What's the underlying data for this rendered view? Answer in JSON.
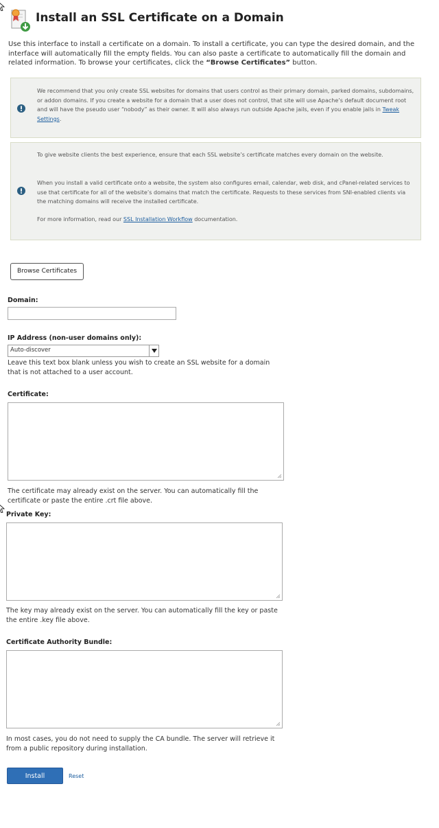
{
  "page": {
    "title": "Install an SSL Certificate on a Domain",
    "intro_text": "Use this interface to install a certificate on a domain. To install a certificate, you can type the desired domain, and the interface will automatically fill the empty fields. You can also paste a certificate to automatically fill the domain and related information. To browse your certificates, click the ",
    "intro_bold": "“Browse Certificates”",
    "intro_end": " button."
  },
  "callout1": {
    "text": "We recommend that you only create SSL websites for domains that users control as their primary domain, parked domains, subdomains, or addon domains. If you create a website for a domain that a user does not control, that site will use Apache’s default document root and will have the pseudo user “nobody” as their owner. It will also always run outside Apache jails, even if you enable jails in ",
    "link": "Tweak Settings",
    "end": "."
  },
  "callout2": {
    "p1": "To give website clients the best experience, ensure that each SSL website’s certificate matches every domain on the website.",
    "p2": "When you install a valid certificate onto a website, the system also configures email, calendar, web disk, and cPanel-related services to use that certificate for all of the website’s domains that match the certificate. Requests to these services from SNI-enabled clients via the matching domains will receive the installed certificate.",
    "p3_start": "For more information, read our ",
    "p3_link": "SSL Installation Workflow",
    "p3_end": " documentation."
  },
  "buttons": {
    "browse": "Browse Certificates",
    "install": "Install",
    "reset": "Reset"
  },
  "form": {
    "domain_label": "Domain:",
    "domain_value": "",
    "ip_label": "IP Address (non-user domains only):",
    "ip_selected": "Auto-discover",
    "ip_help": "Leave this text box blank unless you wish to create an SSL website for a domain that is not attached to a user account.",
    "cert_label": "Certificate:",
    "cert_help": "The certificate may already exist on the server. You can automatically fill the certificate or paste the entire .crt file above.",
    "key_label": "Private Key:",
    "key_help": "The key may already exist on the server. You can automatically fill the key or paste the entire .key file above.",
    "ca_label": "Certificate Authority Bundle:",
    "ca_help": "In most cases, you do not need to supply the CA bundle. The server will retrieve it from a public repository during installation."
  },
  "icons": {
    "title": "certificate-install-icon",
    "info": "info-icon",
    "dropdown": "dropdown-arrow-icon",
    "resize": "resize-grip-icon",
    "cursor": "mouse-cursor-icon"
  },
  "colors": {
    "primary_button": "#2f6fb6",
    "link": "#1a5c9e",
    "callout_bg": "#f0f1ef",
    "info_icon": "#2b5f82"
  }
}
